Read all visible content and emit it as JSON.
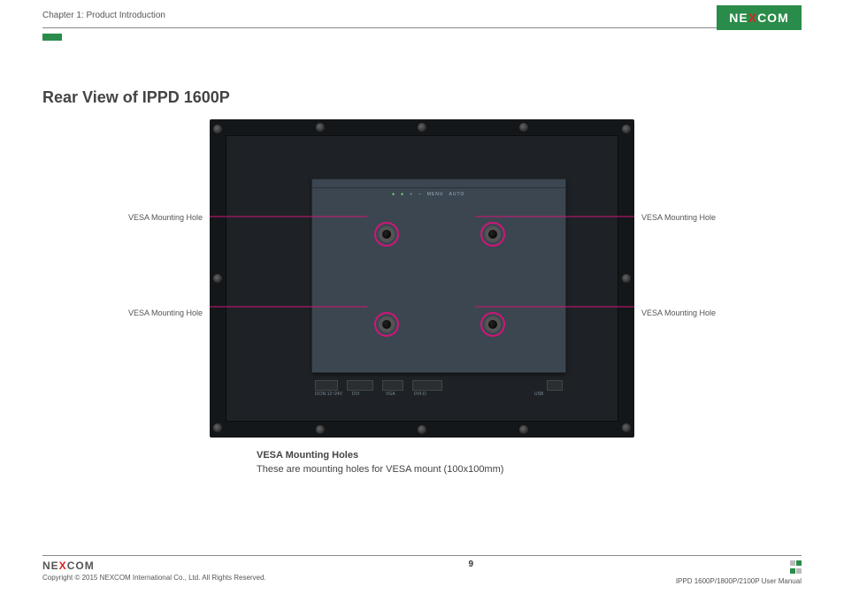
{
  "header": {
    "chapter": "Chapter 1: Product Introduction",
    "logo": {
      "pre": "NE",
      "x": "X",
      "post": "COM"
    }
  },
  "title": "Rear View of IPPD 1600P",
  "labels": {
    "top_left": "VESA Mounting Hole",
    "bottom_left": "VESA Mounting Hole",
    "top_right": "VESA Mounting Hole",
    "bottom_right": "VESA Mounting Hole"
  },
  "panel_leds": [
    "●",
    "●",
    "+",
    "–",
    "MENU",
    "AUTO"
  ],
  "port_labels": [
    "DCIN 12~24V",
    "DVI",
    "VGA",
    "DVI-D",
    "USB"
  ],
  "caption": {
    "title": "VESA Mounting Holes",
    "body": "These are mounting holes for VESA mount (100x100mm)"
  },
  "footer": {
    "logo": {
      "pre": "NE",
      "x": "X",
      "post": "COM"
    },
    "copyright": "Copyright © 2015 NEXCOM International Co., Ltd. All Rights Reserved.",
    "page_number": "9",
    "doc_ref": "IPPD 1600P/1800P/2100P User Manual"
  }
}
